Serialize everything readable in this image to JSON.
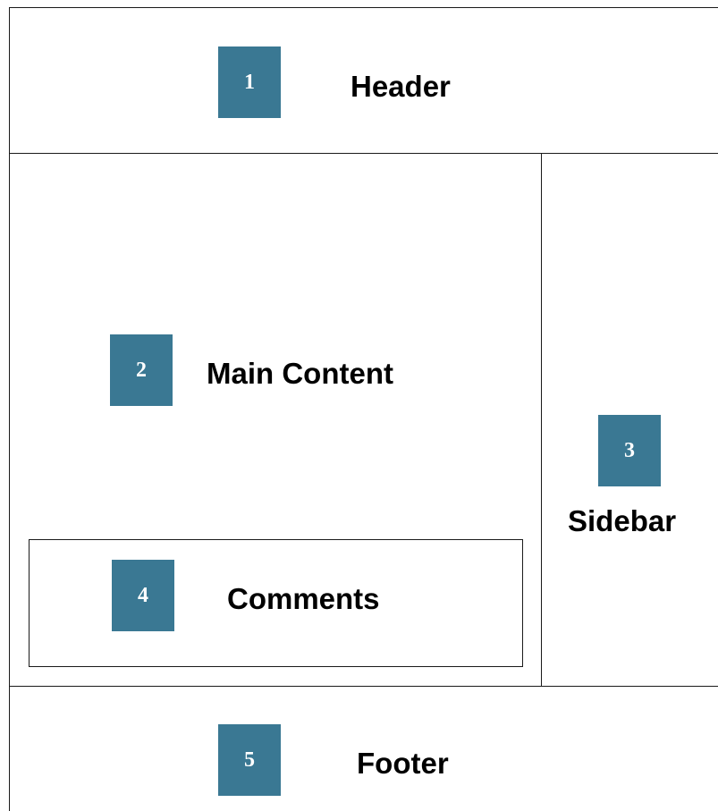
{
  "colors": {
    "badge": "#3a7893",
    "border": "#1a1a1a",
    "background": "#ffffff",
    "text": "#000000"
  },
  "regions": {
    "header": {
      "number": "1",
      "label": "Header"
    },
    "main_content": {
      "number": "2",
      "label": "Main Content"
    },
    "sidebar": {
      "number": "3",
      "label": "Sidebar"
    },
    "comments": {
      "number": "4",
      "label": "Comments"
    },
    "footer": {
      "number": "5",
      "label": "Footer"
    }
  }
}
